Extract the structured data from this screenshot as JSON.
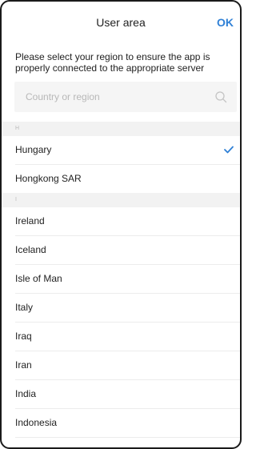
{
  "header": {
    "title": "User area",
    "ok_label": "OK"
  },
  "description": "Please select your region to ensure the app is properly connected to the appropriate server",
  "search": {
    "placeholder": "Country or region",
    "value": ""
  },
  "sections": [
    {
      "letter": "H",
      "items": [
        {
          "name": "Hungary",
          "selected": true
        },
        {
          "name": "Hongkong SAR",
          "selected": false
        }
      ]
    },
    {
      "letter": "I",
      "items": [
        {
          "name": "Ireland",
          "selected": false
        },
        {
          "name": "Iceland",
          "selected": false
        },
        {
          "name": "Isle of Man",
          "selected": false
        },
        {
          "name": "Italy",
          "selected": false
        },
        {
          "name": "Iraq",
          "selected": false
        },
        {
          "name": "Iran",
          "selected": false
        },
        {
          "name": "India",
          "selected": false
        },
        {
          "name": "Indonesia",
          "selected": false
        }
      ]
    }
  ],
  "colors": {
    "accent": "#2f80d6",
    "section_bg": "#f2f2f2",
    "search_bg": "#f5f5f5"
  },
  "icons": {
    "search": "search-icon",
    "selected": "checkmark-icon"
  }
}
